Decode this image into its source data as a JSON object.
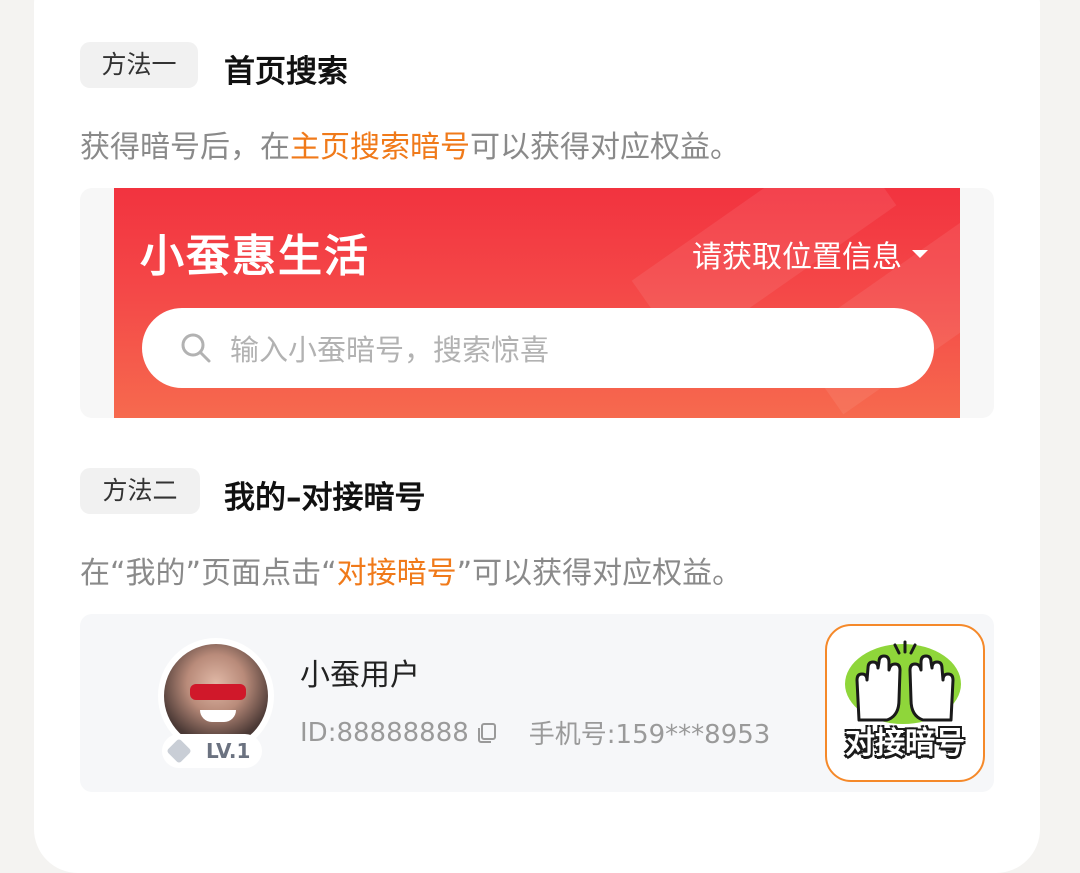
{
  "method1": {
    "tag": "方法一",
    "title": "首页搜索",
    "desc_prefix": "获得暗号后，在",
    "desc_highlight": "主页搜索暗号",
    "desc_suffix": "可以获得对应权益。"
  },
  "preview1": {
    "brand": "小蚕惠生活",
    "location": "请获取位置信息",
    "search_placeholder": "输入小蚕暗号，搜索惊喜"
  },
  "method2": {
    "tag": "方法二",
    "title": "我的–对接暗号",
    "desc_prefix": "在“我的”页面点击“",
    "desc_highlight": "对接暗号",
    "desc_suffix": "”可以获得对应权益。"
  },
  "preview2": {
    "username": "小蚕用户",
    "level": "LV.1",
    "id_text": "ID:88888888",
    "phone_text": "手机号:159***8953",
    "code_button_label": "对接暗号"
  },
  "colors": {
    "accent": "#f07a1a",
    "banner_red": "#f2333f",
    "muted_text": "#8a8a8a"
  }
}
